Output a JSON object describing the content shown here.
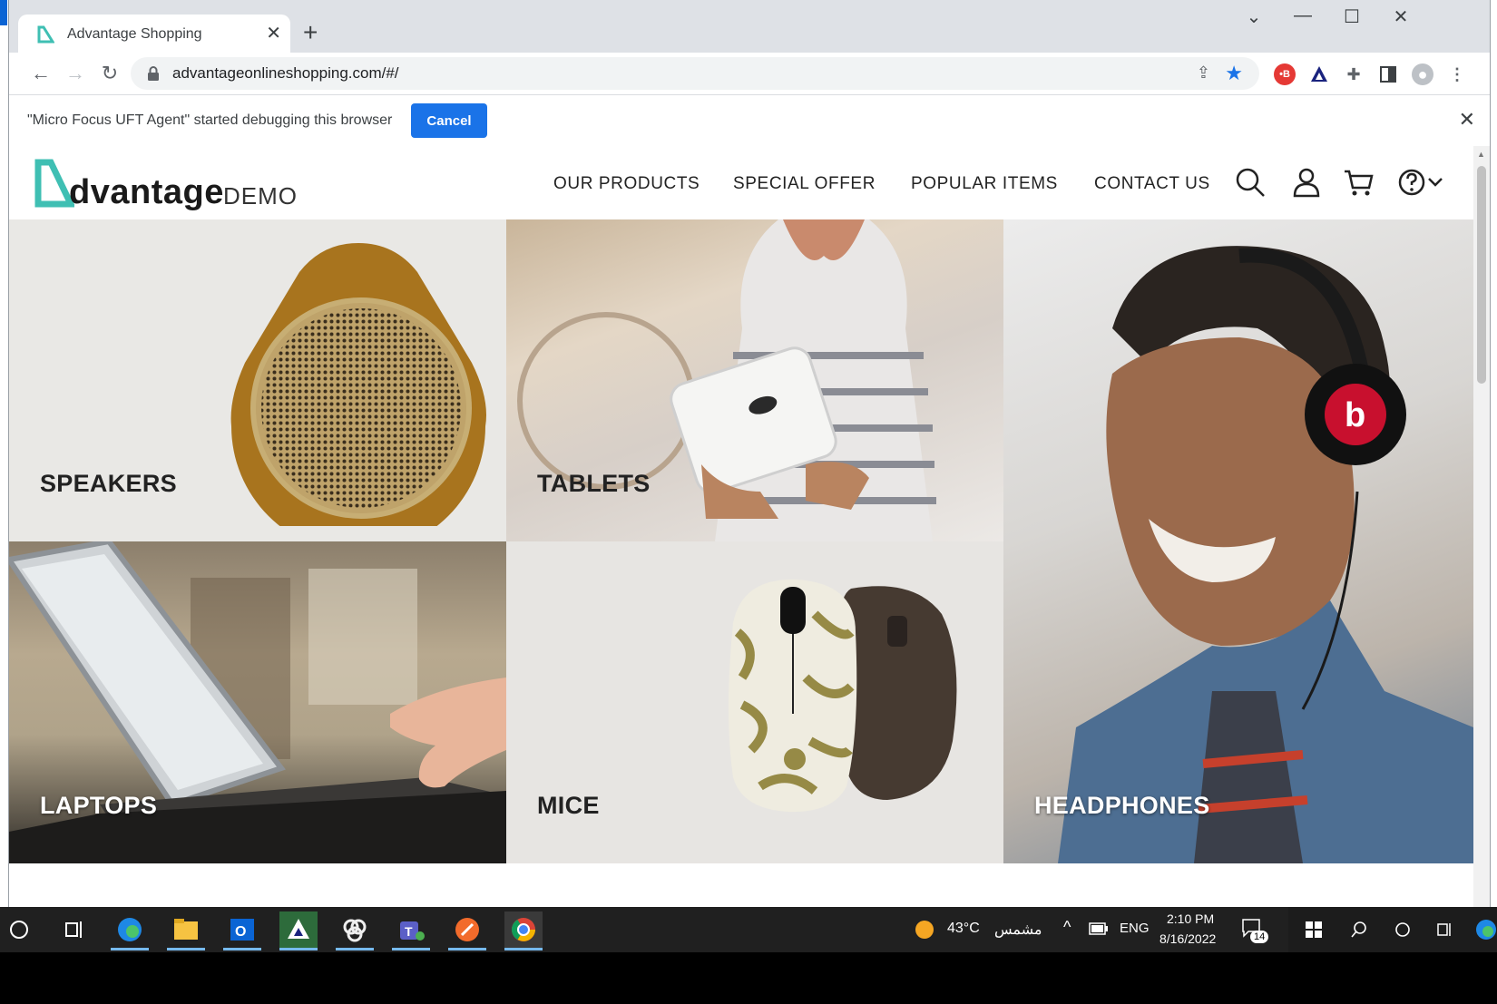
{
  "browser": {
    "tab_title": "Advantage Shopping",
    "tab_close": "✕",
    "new_tab": "+",
    "window_controls": {
      "menu": "⌄",
      "minimize": "—",
      "maximize": "☐",
      "close": "✕"
    },
    "url": "advantageonlineshopping.com/#/",
    "nav": {
      "back": "←",
      "forward": "→",
      "reload": "↻"
    },
    "bookmark_color": "#1a73e8",
    "infobar": {
      "message": "\"Micro Focus UFT Agent\" started debugging this browser",
      "cancel_label": "Cancel",
      "close": "✕"
    }
  },
  "site": {
    "logo_word": "dvantage",
    "logo_demo": "DEMO",
    "brand_color": "#3fbfb3",
    "nav": [
      {
        "label": "OUR PRODUCTS"
      },
      {
        "label": "SPECIAL OFFER"
      },
      {
        "label": "POPULAR ITEMS"
      },
      {
        "label": "CONTACT US"
      }
    ],
    "header_icons": [
      "search-icon",
      "user-icon",
      "cart-icon",
      "help-icon",
      "chevron-down-icon"
    ]
  },
  "categories": [
    {
      "label": "SPEAKERS",
      "text_color": "#222222"
    },
    {
      "label": "TABLETS",
      "text_color": "#222222"
    },
    {
      "label": "LAPTOPS",
      "text_color": "#ffffff"
    },
    {
      "label": "MICE",
      "text_color": "#222222"
    },
    {
      "label": "HEADPHONES",
      "text_color": "#ffffff"
    }
  ],
  "taskbar": {
    "weather": "43°C",
    "weather_text": "مشمس",
    "language": "ENG",
    "time": "2:10 PM",
    "date": "8/16/2022",
    "notifications": "14",
    "apps": [
      "search-circle-icon",
      "task-view-icon",
      "edge-icon",
      "file-explorer-icon",
      "outlook-icon",
      "app-triangle-icon",
      "app-knot-icon",
      "teams-icon",
      "app-orange-icon",
      "chrome-icon"
    ]
  }
}
